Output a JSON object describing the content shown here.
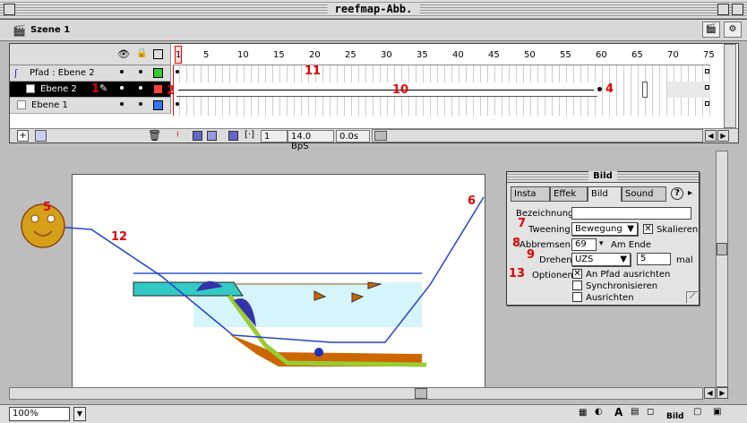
{
  "window": {
    "title": "reefmap-Abb."
  },
  "scene": {
    "label": "Szene 1"
  },
  "timeline": {
    "ruler_ticks": [
      "1",
      "5",
      "10",
      "15",
      "20",
      "25",
      "30",
      "35",
      "40",
      "45",
      "50",
      "55",
      "60",
      "65",
      "70",
      "75"
    ],
    "layers": [
      {
        "name": "Pfad : Ebene 2",
        "color": "#33cc33",
        "selected": false
      },
      {
        "name": "Ebene 2",
        "color": "#ff4040",
        "selected": true
      },
      {
        "name": "Ebene 1",
        "color": "#3377ee",
        "selected": false
      }
    ],
    "current_frame": "1",
    "frame_rate": "14.0 BpS",
    "elapsed": "0.0s"
  },
  "annotations": {
    "n1": "1",
    "n2": "2",
    "n4": "4",
    "n5": "5",
    "n6": "6",
    "n7": "7",
    "n8": "8",
    "n9": "9",
    "n10": "10",
    "n11": "11",
    "n12": "12",
    "n13": "13"
  },
  "panel": {
    "title": "Bild",
    "tabs": [
      "Insta",
      "Effek",
      "Bild",
      "Sound"
    ],
    "bezeichnung_label": "Bezeichnung :",
    "bezeichnung_value": "",
    "tweening_label": "Tweening :",
    "tweening_value": "Bewegung",
    "skalieren_label": "Skalieren",
    "skalieren_checked": true,
    "abbremsen_label": "Abbremsen :",
    "abbremsen_value": "69",
    "am_ende_label": "Am Ende",
    "drehen_label": "Drehen :",
    "drehen_value": "UZS",
    "drehen_count": "5",
    "mal_label": "mal",
    "optionen_label": "Optionen :",
    "options": [
      {
        "label": "An Pfad ausrichten",
        "checked": true
      },
      {
        "label": "Synchronisieren",
        "checked": false
      },
      {
        "label": "Ausrichten",
        "checked": false
      }
    ]
  },
  "status": {
    "zoom": "100%",
    "dock_label": "Bild"
  }
}
